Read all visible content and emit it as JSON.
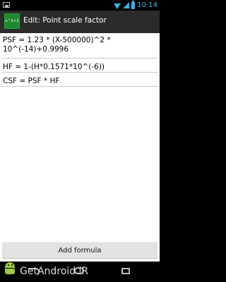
{
  "status_bar": {
    "time": "10:14"
  },
  "action_bar": {
    "icon_text": "x^2+1",
    "title": "Edit: Point scale factor"
  },
  "formulas": [
    {
      "text": "PSF = 1.23 * (X-500000)^2 * 10^(-14)+0.9996"
    },
    {
      "text": "HF = 1-(H*0.1571*10^(-6))"
    },
    {
      "text": "CSF = PSF * HF"
    }
  ],
  "buttons": {
    "add_formula": "Add formula"
  },
  "watermark": {
    "text": "GetAndroid.iR"
  }
}
